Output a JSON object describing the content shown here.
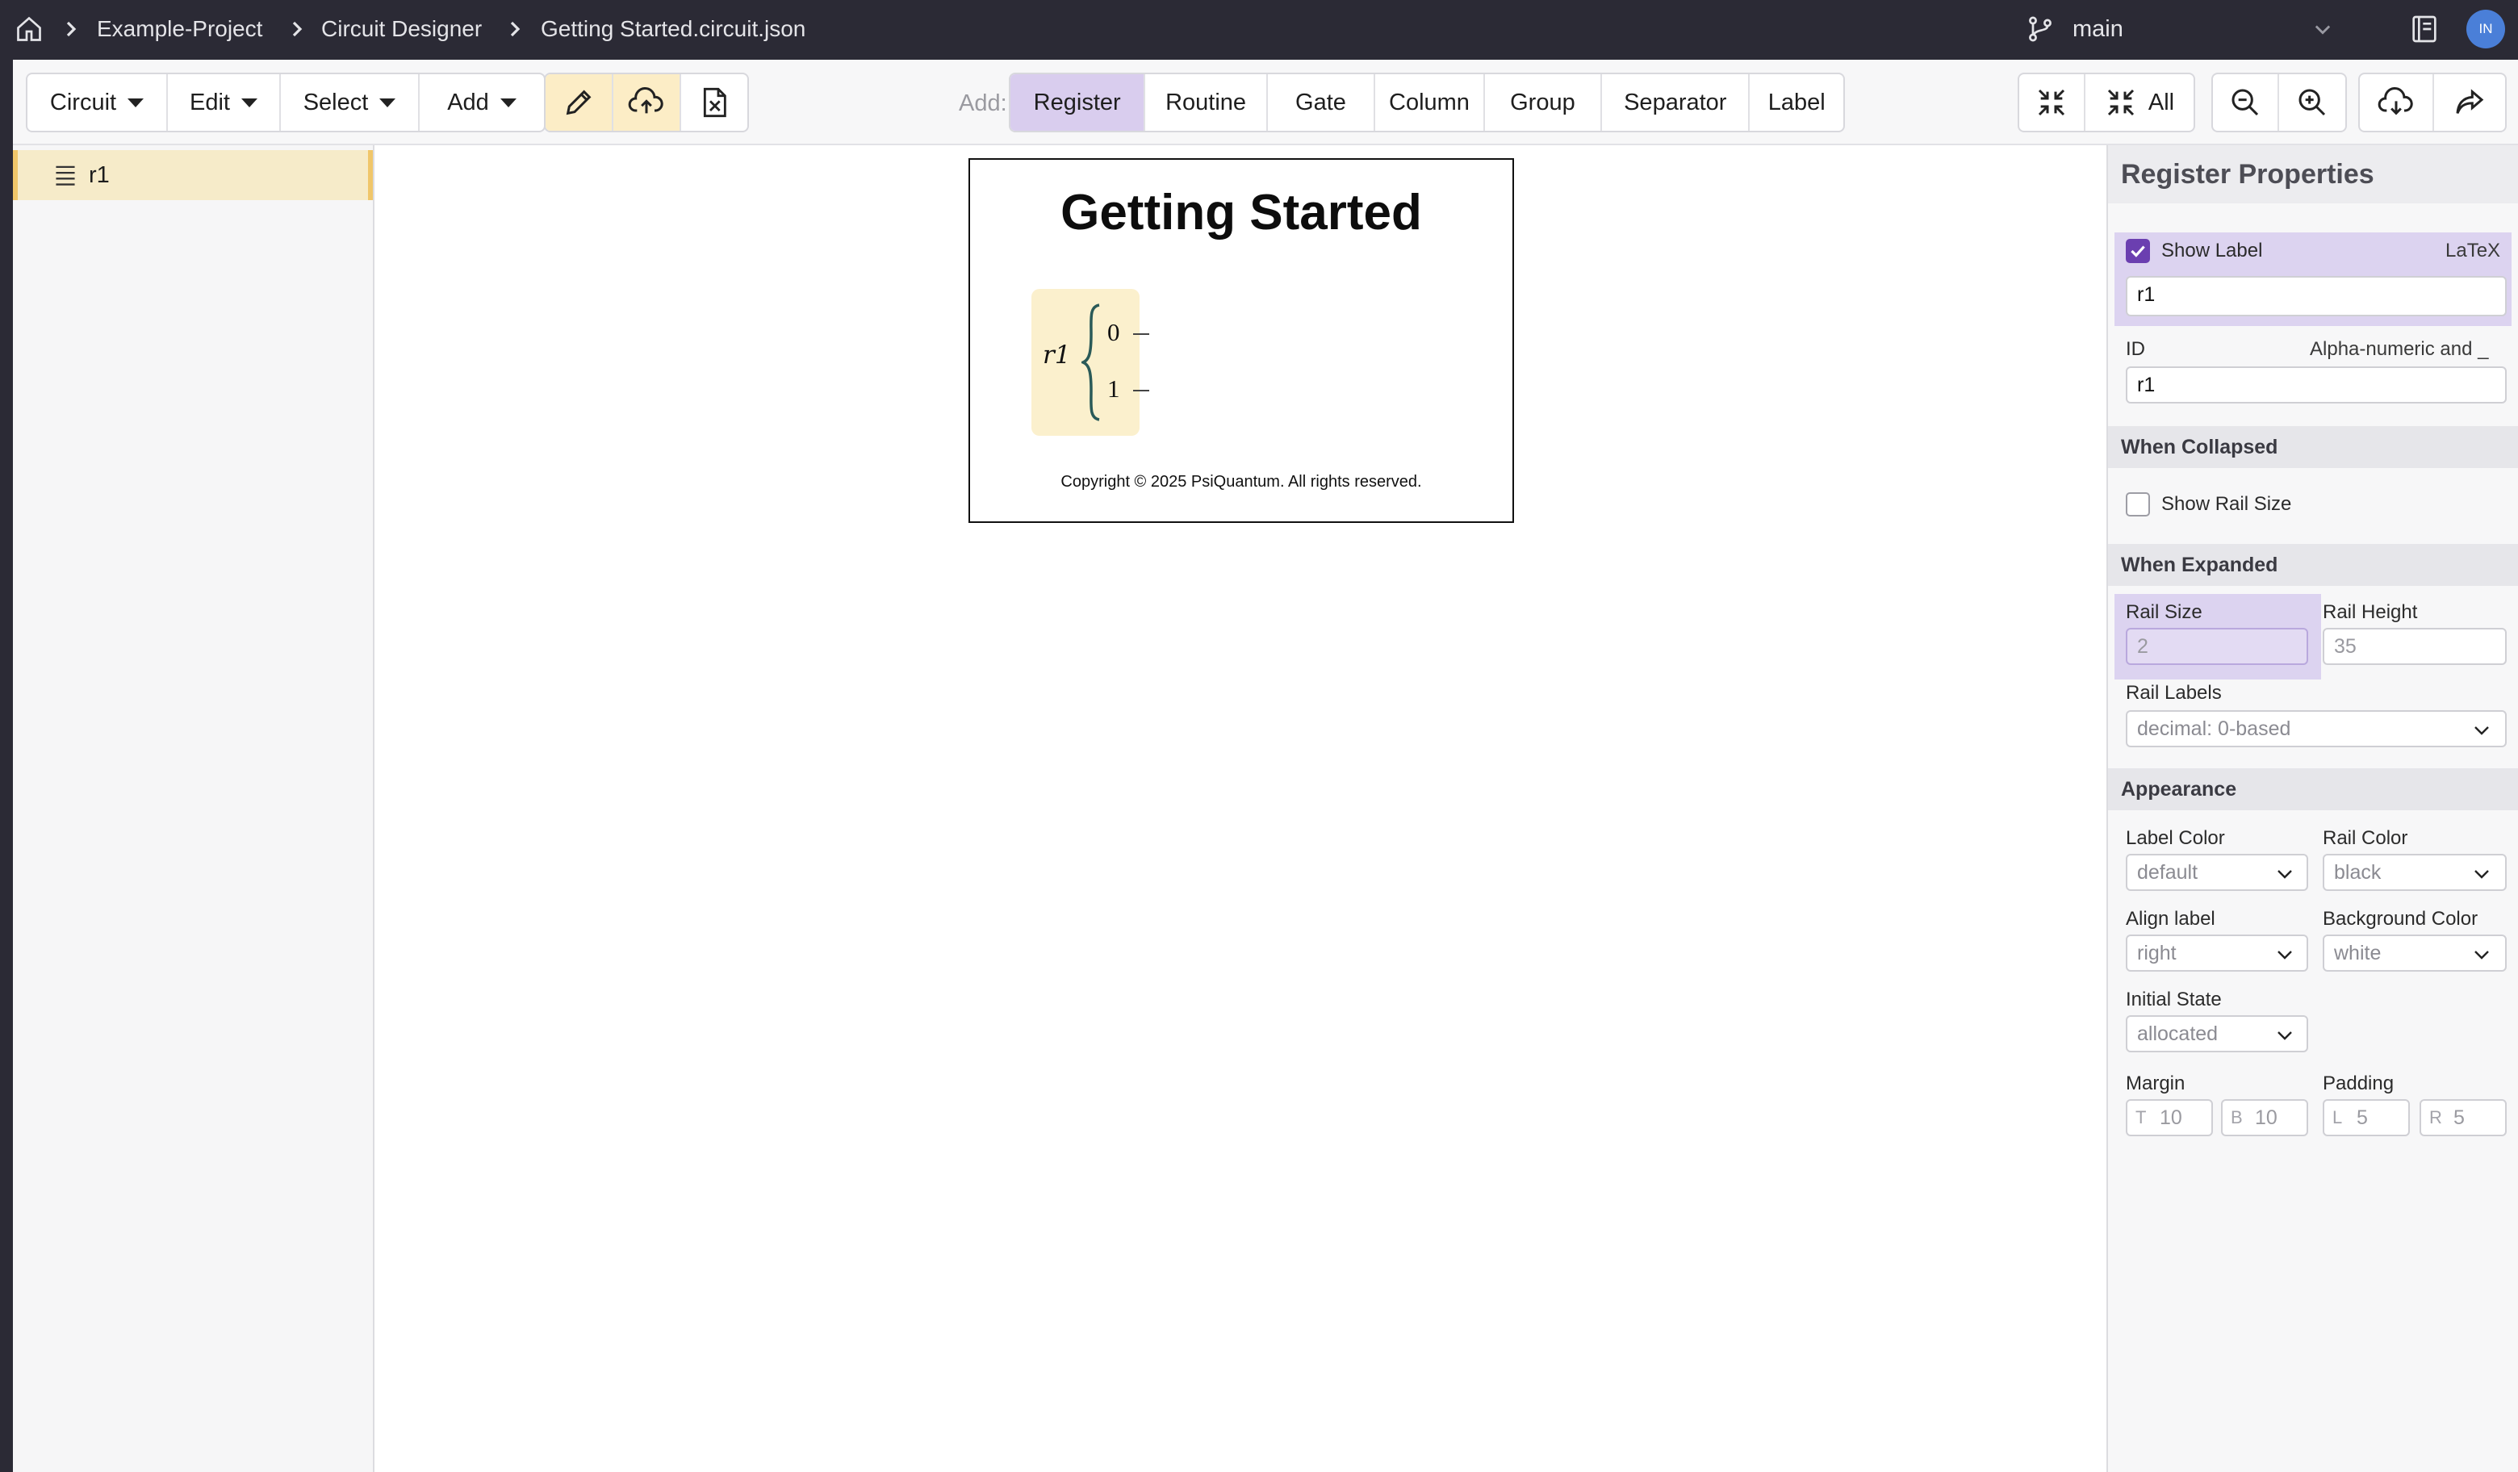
{
  "breadcrumb": {
    "items": [
      "Example-Project",
      "Circuit Designer",
      "Getting Started.circuit.json"
    ]
  },
  "branch": {
    "name": "main"
  },
  "user": {
    "initials": "IN"
  },
  "toolbar": {
    "menus": [
      "Circuit",
      "Edit",
      "Select",
      "Add"
    ],
    "add_label": "Add:",
    "add_items": [
      "Register",
      "Routine",
      "Gate",
      "Column",
      "Group",
      "Separator",
      "Label"
    ],
    "selected_add_item": "Register",
    "collapse_all_label": "All"
  },
  "tree": {
    "items": [
      {
        "label": "r1"
      }
    ]
  },
  "diagram": {
    "title": "Getting Started",
    "register_label": "r1",
    "rail_labels": [
      "0",
      "1"
    ],
    "copyright": "Copyright © 2025 PsiQuantum. All rights reserved."
  },
  "properties": {
    "title": "Register Properties",
    "show_label": {
      "label": "Show Label",
      "checked": true,
      "hint": "LaTeX",
      "value": "r1"
    },
    "id": {
      "label": "ID",
      "hint": "Alpha-numeric and _",
      "value": "r1"
    },
    "when_collapsed": {
      "heading": "When Collapsed",
      "show_rail_size": {
        "label": "Show Rail Size",
        "checked": false
      }
    },
    "when_expanded": {
      "heading": "When Expanded",
      "rail_size": {
        "label": "Rail Size",
        "value": "2"
      },
      "rail_height": {
        "label": "Rail Height",
        "value": "35"
      },
      "rail_labels": {
        "label": "Rail Labels",
        "value": "decimal: 0-based"
      }
    },
    "appearance": {
      "heading": "Appearance",
      "label_color": {
        "label": "Label Color",
        "value": "default"
      },
      "rail_color": {
        "label": "Rail Color",
        "value": "black"
      },
      "align_label": {
        "label": "Align label",
        "value": "right"
      },
      "background_color": {
        "label": "Background Color",
        "value": "white"
      },
      "initial_state": {
        "label": "Initial State",
        "value": "allocated"
      },
      "margin": {
        "label": "Margin",
        "top_prefix": "T",
        "top": "10",
        "bottom_prefix": "B",
        "bottom": "10"
      },
      "padding": {
        "label": "Padding",
        "left_prefix": "L",
        "left": "5",
        "right_prefix": "R",
        "right": "5"
      }
    }
  },
  "colors": {
    "topbar": "#2b2a35",
    "accent_purple": "#6b3fb0",
    "selection_highlight": "#dcd3f0",
    "register_fill": "#fbf0cd",
    "active_tool": "#fcedc6"
  }
}
